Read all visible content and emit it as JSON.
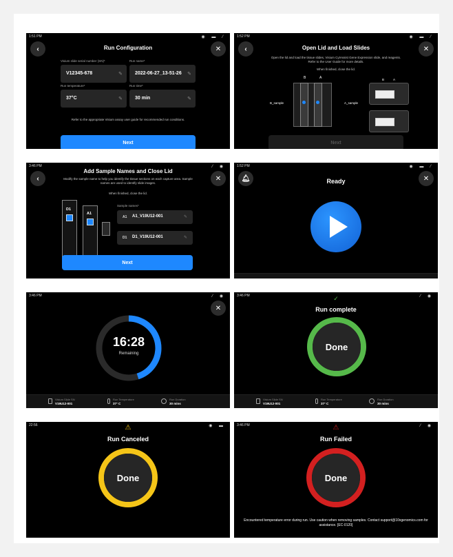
{
  "screens": {
    "config": {
      "time": "1:51 PM",
      "title": "Run Configuration",
      "fields": [
        {
          "label": "Visium slide serial number (SN)*",
          "value": "V12345-678"
        },
        {
          "label": "Run name*",
          "value": "2022-06-27_13-51-26"
        },
        {
          "label": "Run temperature*",
          "value": "37°C"
        },
        {
          "label": "Run time*",
          "value": "30 min"
        }
      ],
      "note": "Refer to the appropriate Visium assay user guide for recommended run conditions.",
      "next_label": "Next"
    },
    "load": {
      "time": "1:52 PM",
      "title": "Open Lid and Load Slides",
      "instructions": "Open the lid and load the tissue slides, Visium CytAssist Gene Expression slide, and reagents. Refer to the User Guide for more details.",
      "finish": "When finished, close the lid.",
      "label_b": "B",
      "label_a": "A",
      "label_b_sample": "B_sample",
      "label_a_sample": "A_sample",
      "next_label": "Next"
    },
    "names": {
      "time": "3:46 PM",
      "title": "Add Sample Names and Close Lid",
      "instructions": "Modify the sample name to help you identify the tissue sections on each capture area. Sample names are used to identify slide images.",
      "finish": "When finished, close the lid.",
      "label_d1": "D1",
      "label_a1": "A1",
      "sample_names_label": "Sample names*",
      "samples": [
        {
          "tag": "A1",
          "name": "A1_V19U12-001"
        },
        {
          "tag": "D1",
          "name": "D1_V19U12-001"
        }
      ],
      "next_label": "Next"
    },
    "ready": {
      "time": "1:52 PM",
      "title": "Ready"
    },
    "running": {
      "time": "3:46 PM",
      "timer": "16:28",
      "remaining": "Remaining",
      "progress": 0.45
    },
    "complete": {
      "time": "3:46 PM",
      "title": "Run complete",
      "done": "Done"
    },
    "canceled": {
      "time": "22:56",
      "title": "Run Canceled",
      "done": "Done"
    },
    "failed": {
      "time": "3:46 PM",
      "title": "Run Failed",
      "done": "Done",
      "error": "Encountered temperature error during run. Use caution when removing samples. Contact support@10xgenomics.com for assistance. [EC-0120]"
    }
  },
  "footer": {
    "slide_label": "Visium Slide SN",
    "slide_value": "V19U12-001",
    "temp_label": "Run Temperature",
    "temp_value": "37° C",
    "dur_label": "Run Duration",
    "dur_value": "30 mins"
  },
  "colors": {
    "accent": "#1e88ff",
    "success": "#56b94a",
    "warning": "#f5c518",
    "error": "#d32020",
    "ring_track": "#2a2a2a"
  }
}
